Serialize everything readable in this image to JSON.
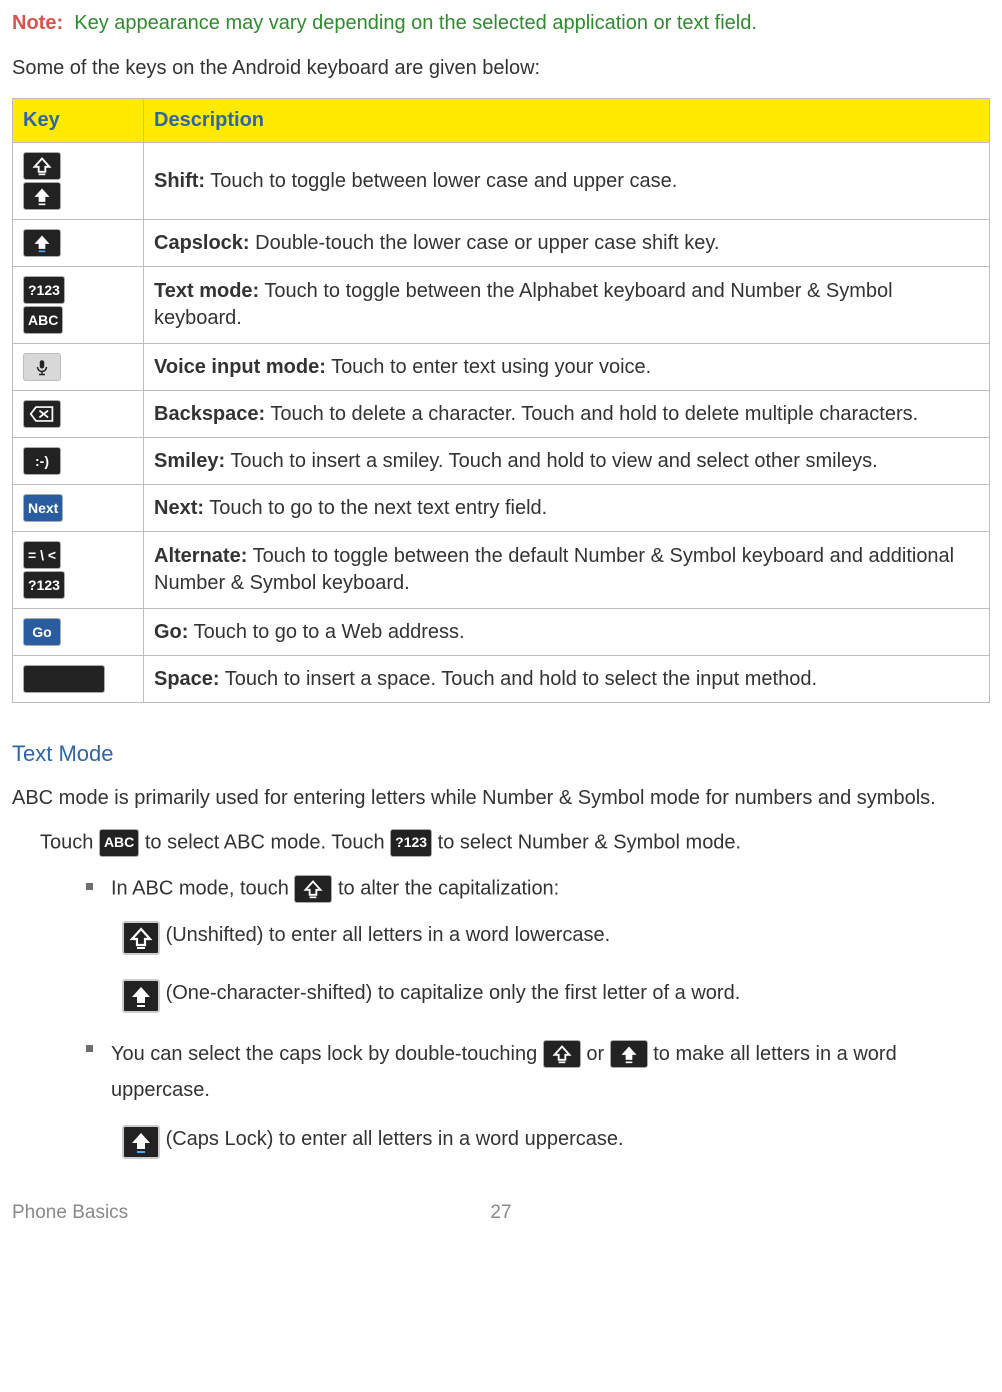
{
  "note": {
    "label": "Note:",
    "text": "Key appearance may vary depending on the selected application or text field."
  },
  "intro": "Some of the keys on the Android keyboard are given below:",
  "table": {
    "headers": {
      "key": "Key",
      "desc": "Description"
    },
    "rows": [
      {
        "name": "Shift:",
        "desc": "Touch to toggle between lower case and upper case."
      },
      {
        "name": "Capslock:",
        "desc": "Double-touch the lower case or upper case shift key."
      },
      {
        "name": "Text mode:",
        "desc": "Touch to toggle between the Alphabet keyboard and Number & Symbol keyboard."
      },
      {
        "name": "Voice input mode:",
        "desc": "Touch to enter text using your voice."
      },
      {
        "name": "Backspace:",
        "desc": "Touch to delete a character. Touch and hold to delete multiple characters."
      },
      {
        "name": "Smiley:",
        "desc": "Touch to insert a smiley. Touch and hold to view and select other smileys."
      },
      {
        "name": "Next:",
        "desc": "Touch to go to the next text entry field."
      },
      {
        "name": "Alternate:",
        "desc": "Touch to toggle between the default Number & Symbol keyboard and additional Number & Symbol keyboard."
      },
      {
        "name": "Go:",
        "desc": "Touch to go to a Web address."
      },
      {
        "name": "Space:",
        "desc": "Touch to insert a space. Touch and hold to select the input method."
      }
    ]
  },
  "section": {
    "heading": "Text Mode",
    "p1": "ABC mode is primarily used for entering letters while Number & Symbol mode for numbers and symbols.",
    "line_touch_a": "Touch ",
    "line_touch_b": " to select ABC mode. Touch ",
    "line_touch_c": " to select Number & Symbol mode.",
    "b1": "In ABC mode, touch ",
    "b1b": " to alter the capitalization:",
    "unshifted": " (Unshifted) to enter all letters in a word lowercase.",
    "onechar": " (One-character-shifted) to capitalize only the first letter of a word.",
    "b2a": "You can select the caps lock by double-touching ",
    "b2b": " or ",
    "b2c": " to make all letters in a word uppercase.",
    "capslock": " (Caps Lock) to enter all letters in a word uppercase."
  },
  "key_labels": {
    "q123": "?123",
    "abc": "ABC",
    "smiley": ":-)",
    "next": "Next",
    "alt": "= \\ <",
    "go": "Go"
  },
  "footer": {
    "section": "Phone Basics",
    "page": "27"
  }
}
